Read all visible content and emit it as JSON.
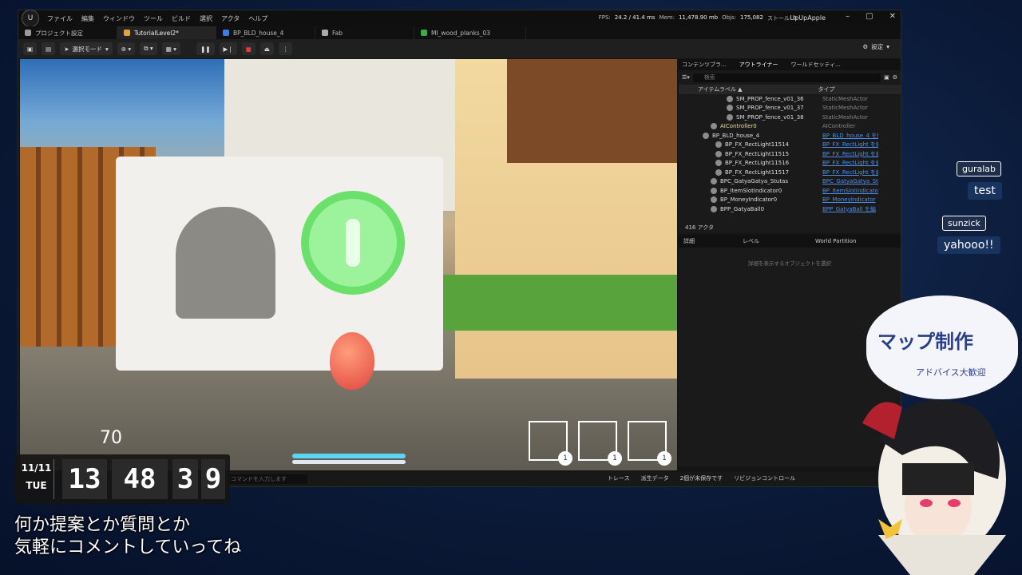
{
  "menu": {
    "logo": "U",
    "items": [
      "ファイル",
      "編集",
      "ウィンドウ",
      "ツール",
      "ビルド",
      "選択",
      "アクタ",
      "ヘルプ"
    ]
  },
  "stats": {
    "fps_label": "FPS:",
    "fps": "24.2 / 41.4 ms",
    "mem_label": "Mem:",
    "mem": "11,478.90 mb",
    "objs_label": "Objs:",
    "objs": "175,082",
    "stall": "ストール: 0"
  },
  "project_name": "UpUpApple",
  "window_controls": {
    "minimize": "–",
    "maximize": "▢",
    "close": "✕"
  },
  "tabs": [
    {
      "label": "プロジェクト設定",
      "color": "#9a9a9a"
    },
    {
      "label": "TutorialLevel2*",
      "color": "#e8a23c"
    },
    {
      "label": "BP_BLD_house_4",
      "color": "#3b7de0"
    },
    {
      "label": "Fab",
      "color": "#aaaaaa"
    },
    {
      "label": "MI_wood_planks_03",
      "color": "#33b04a"
    }
  ],
  "toolbar": {
    "select_mode": "選択モード",
    "settings": "設定"
  },
  "viewport": {
    "hud_number": "70",
    "slot_counts": [
      "1",
      "1",
      "1"
    ]
  },
  "outliner": {
    "tabs": [
      "コンテンツブラ...",
      "アウトライナー",
      "ワールドセッティ..."
    ],
    "search_placeholder": "検索",
    "col_label": "アイテムラベル ▲",
    "col_type": "タイプ",
    "rows": [
      {
        "name": "SM_PROP_fence_v01_36",
        "type": "StaticMeshActor",
        "link": false,
        "indent": 60
      },
      {
        "name": "SM_PROP_fence_v01_37",
        "type": "StaticMeshActor",
        "link": false,
        "indent": 60
      },
      {
        "name": "SM_PROP_fence_v01_38",
        "type": "StaticMeshActor",
        "link": false,
        "indent": 60
      },
      {
        "name": "AIController0",
        "type": "AIController",
        "link": false,
        "indent": 40,
        "color": "#e6e08a"
      },
      {
        "name": "BP_BLD_house_4",
        "type": "BP_BLD_house_4 を編",
        "link": true,
        "indent": 30
      },
      {
        "name": "BP_FX_RectLight11514",
        "type": "BP_FX_RectLight を編",
        "link": true,
        "indent": 46
      },
      {
        "name": "BP_FX_RectLight11515",
        "type": "BP_FX_RectLight を編",
        "link": true,
        "indent": 46
      },
      {
        "name": "BP_FX_RectLight11516",
        "type": "BP_FX_RectLight を編",
        "link": true,
        "indent": 46
      },
      {
        "name": "BP_FX_RectLight11517",
        "type": "BP_FX_RectLight を編",
        "link": true,
        "indent": 46
      },
      {
        "name": "BPC_GatyaGatya_Stutas",
        "type": "BPC_GatyaGatya_St",
        "link": true,
        "indent": 40
      },
      {
        "name": "BP_ItemSlotIndicator0",
        "type": "BP_ItemSlotIndicato",
        "link": true,
        "indent": 40
      },
      {
        "name": "BP_MoneyIndicator0",
        "type": "BP_MoneyIndicator",
        "link": true,
        "indent": 40
      },
      {
        "name": "BPP_GatyaBall0",
        "type": "BPP_GatyaBall を編",
        "link": true,
        "indent": 40
      }
    ],
    "actor_count": "416 アクタ"
  },
  "details": {
    "tabs": [
      "詳細",
      "レベル",
      "World Partition"
    ],
    "empty_message": "詳細を表示するオブジェクトを選択"
  },
  "statusbar": {
    "cmd_placeholder": "コマンドを入力します",
    "trace": "トレース",
    "derived_data": "派生データ",
    "unsaved": "2個が未保存です",
    "revision": "リビジョンコントロール"
  },
  "clock": {
    "date": "11/11",
    "weekday": "TUE",
    "hour": "13",
    "minute": "48",
    "sec_tens": "3",
    "sec_ones": "9"
  },
  "caption": {
    "line1": "何か提案とか質問とか",
    "line2": "気軽にコメントしていってね"
  },
  "chat": [
    {
      "user": "guralab",
      "message": "test"
    },
    {
      "user": "sunzick",
      "message": "yahooo!!"
    }
  ],
  "bubble": {
    "title": "マップ制作",
    "subtitle": "アドバイス大歓迎"
  }
}
